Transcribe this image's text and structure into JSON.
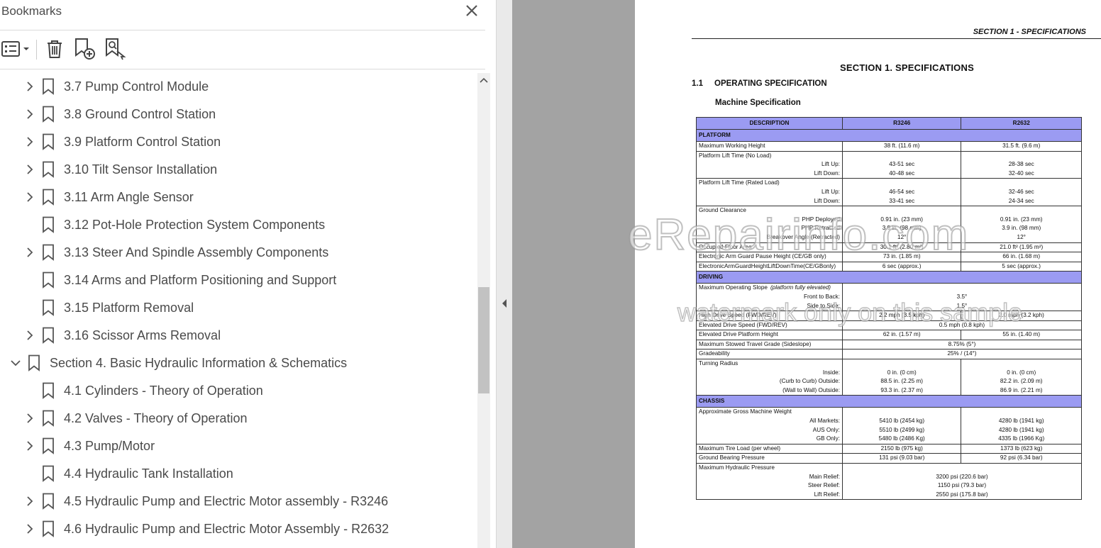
{
  "bookmarks_panel": {
    "title": "Bookmarks",
    "toolbar": {
      "options_icon": "list-options-icon",
      "delete_icon": "trash-icon",
      "new_bookmark_icon": "add-bookmark-icon",
      "find_bookmark_icon": "bookmark-search-icon"
    },
    "items": [
      {
        "label": "3.7 Pump Control Module",
        "expandable": true,
        "expanded": false,
        "level": 2
      },
      {
        "label": "3.8 Ground Control Station",
        "expandable": true,
        "expanded": false,
        "level": 2
      },
      {
        "label": "3.9 Platform Control Station",
        "expandable": true,
        "expanded": false,
        "level": 2
      },
      {
        "label": "3.10 Tilt Sensor Installation",
        "expandable": true,
        "expanded": false,
        "level": 2
      },
      {
        "label": "3.11 Arm Angle Sensor",
        "expandable": true,
        "expanded": false,
        "level": 2
      },
      {
        "label": "3.12 Pot-Hole Protection System Components",
        "expandable": false,
        "expanded": false,
        "level": 2
      },
      {
        "label": "3.13 Steer And Spindle Assembly Components",
        "expandable": true,
        "expanded": false,
        "level": 2
      },
      {
        "label": "3.14 Arms and Platform Positioning and Support",
        "expandable": false,
        "expanded": false,
        "level": 2
      },
      {
        "label": "3.15 Platform Removal",
        "expandable": false,
        "expanded": false,
        "level": 2
      },
      {
        "label": "3.16 Scissor Arms Removal",
        "expandable": true,
        "expanded": false,
        "level": 2
      },
      {
        "label": "Section 4. Basic Hydraulic Information & Schematics",
        "expandable": true,
        "expanded": true,
        "level": 1
      },
      {
        "label": "4.1 Cylinders - Theory of Operation",
        "expandable": false,
        "expanded": false,
        "level": 2
      },
      {
        "label": "4.2 Valves - Theory of Operation",
        "expandable": true,
        "expanded": false,
        "level": 2
      },
      {
        "label": "4.3 Pump/Motor",
        "expandable": true,
        "expanded": false,
        "level": 2
      },
      {
        "label": "4.4 Hydraulic Tank Installation",
        "expandable": false,
        "expanded": false,
        "level": 2
      },
      {
        "label": "4.5 Hydraulic Pump and Electric Motor assembly - R3246",
        "expandable": true,
        "expanded": false,
        "level": 2
      },
      {
        "label": "4.6 Hydraulic Pump and Electric Motor Assembly - R2632",
        "expandable": true,
        "expanded": false,
        "level": 2
      }
    ]
  },
  "document": {
    "header": "SECTION 1 - SPECIFICATIONS",
    "section_title": "SECTION 1.  SPECIFICATIONS",
    "subsection_number": "1.1",
    "subsection_title": "OPERATING SPECIFICATION",
    "table_title": "Machine Specification",
    "table": {
      "headers": [
        "DESCRIPTION",
        "R3246",
        "R2632"
      ],
      "rows": [
        {
          "type": "section",
          "cells": [
            "PLATFORM"
          ]
        },
        {
          "type": "row",
          "cells": [
            "Maximum Working Height",
            "38 ft. (11.6 m)",
            "31.5 ft. (9.6 m)"
          ]
        },
        {
          "type": "multi",
          "title": "Platform Lift Time (No Load)",
          "labels": [
            "Lift Up:",
            "Lift Down:"
          ],
          "v1": [
            "43-51 sec",
            "40-48 sec"
          ],
          "v2": [
            "28-38 sec",
            "32-40 sec"
          ]
        },
        {
          "type": "multi",
          "title": "Platform Lift Time (Rated Load)",
          "labels": [
            "Lift Up:",
            "Lift Down:"
          ],
          "v1": [
            "46-54 sec",
            "33-41 sec"
          ],
          "v2": [
            "32-46 sec",
            "24-34 sec"
          ]
        },
        {
          "type": "multi",
          "title": "Ground Clearance",
          "labels": [
            "PHP Deployed",
            "PHP Retracted",
            "Breakover Angle (Retracted)"
          ],
          "v1": [
            "0.91 in. (23 mm)",
            "3.9 in. (98 mm)",
            "12°"
          ],
          "v2": [
            "0.91 in. (23 mm)",
            "3.9 in. (98 mm)",
            "12°"
          ]
        },
        {
          "type": "row",
          "cells": [
            "Occupied Floor Area",
            "30.1 ft² (2.80 m²)",
            "21.0 ft² (1.95 m²)"
          ]
        },
        {
          "type": "row",
          "cells": [
            "Electronic Arm Guard Pause Height (CE/GB only)",
            "73 in. (1.85 m)",
            "66 in. (1.68 m)"
          ]
        },
        {
          "type": "row",
          "cells": [
            "ElectronicArmGuardHeightLiftDownTime(CE/GBonly)",
            "6 sec (approx.)",
            "5 sec (approx.)"
          ]
        },
        {
          "type": "section",
          "cells": [
            "DRIVING"
          ]
        },
        {
          "type": "multi",
          "title": "Maximum Operating Slope",
          "title_note": "(platform fully elevated)",
          "labels": [
            "Front to Back:",
            "Side to Side:"
          ],
          "span": [
            "3.5°",
            "1.5°"
          ]
        },
        {
          "type": "row",
          "cells": [
            "High Drive Speed (FWD/REV)",
            "2.2 mph (3.5 kph)",
            "2.0 mph (3.2 kph)"
          ]
        },
        {
          "type": "span",
          "cells": [
            "Elevated Drive Speed (FWD/REV)",
            "0.5 mph (0.8 kph)"
          ]
        },
        {
          "type": "row",
          "cells": [
            "Elevated Drive Platform Height",
            "62 in. (1.57 m)",
            "55 in. (1.40 m)"
          ]
        },
        {
          "type": "span",
          "cells": [
            "Maximum Stowed Travel Grade (Sideslope)",
            "8.75% (5°)"
          ]
        },
        {
          "type": "span",
          "cells": [
            "Gradeability",
            "25% / (14°)"
          ]
        },
        {
          "type": "multi",
          "title": "Turning Radius",
          "labels": [
            "Inside:",
            "(Curb to Curb)  Outside:",
            "(Wall to Wall)  Outside:"
          ],
          "v1": [
            "0 in. (0 cm)",
            "88.5 in. (2.25 m)",
            "93.3 in. (2.37 m)"
          ],
          "v2": [
            "0 in. (0 cm)",
            "82.2 in. (2.09 m)",
            "86.9 in. (2.21 m)"
          ]
        },
        {
          "type": "section",
          "cells": [
            "CHASSIS"
          ]
        },
        {
          "type": "multi",
          "title": "Approximate Gross Machine Weight",
          "labels": [
            "All Markets:",
            "AUS Only:",
            "GB Only:"
          ],
          "v1": [
            "5410 lb (2454 kg)",
            "5510 lb (2499 kg)",
            "5480 lb (2486 Kg)"
          ],
          "v2": [
            "4280 lb (1941 kg)",
            "4280 lb (1941 kg)",
            "4335 lb (1966 Kg)"
          ]
        },
        {
          "type": "row",
          "cells": [
            "Maximum Tire Load (per wheel)",
            "2150 lb (975 kg)",
            "1373 lb (623 kg)"
          ]
        },
        {
          "type": "row",
          "cells": [
            "Ground Bearing Pressure",
            "131 psi (9.03 bar)",
            "92 psi (6.34 bar)"
          ]
        },
        {
          "type": "multi",
          "title": "Maximum Hydraulic Pressure",
          "labels": [
            "Main Relief:",
            "Steer Relief:",
            "Lift Relief:"
          ],
          "span": [
            "3200 psi (220.6 bar)",
            "1150 psi (79.3 bar)",
            "2550 psi (175.8 bar)"
          ]
        }
      ]
    },
    "watermark_main": "eRepairinfo.com",
    "watermark_sub": "watermark only on this sample"
  },
  "colors": {
    "table_header_bg": "#9b9bf2",
    "gutter_gray": "#a3a3a3",
    "text_gray": "#4a4a4a"
  }
}
